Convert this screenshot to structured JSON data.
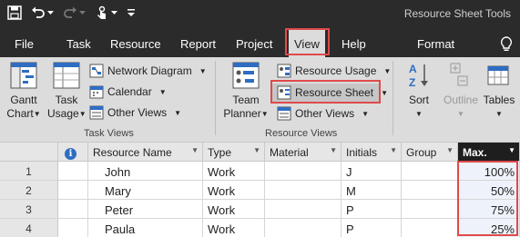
{
  "window": {
    "tools_title": "Resource Sheet Tools"
  },
  "tabs": [
    {
      "label": "File"
    },
    {
      "label": "Task"
    },
    {
      "label": "Resource"
    },
    {
      "label": "Report"
    },
    {
      "label": "Project"
    },
    {
      "label": "View"
    },
    {
      "label": "Help"
    },
    {
      "label": "Format"
    }
  ],
  "ribbon": {
    "task_views": {
      "group_label": "Task Views",
      "gantt_chart": [
        "Gantt",
        "Chart"
      ],
      "task_usage": [
        "Task",
        "Usage"
      ],
      "network_diagram": "Network Diagram",
      "calendar": "Calendar",
      "other_views": "Other Views"
    },
    "resource_views": {
      "group_label": "Resource Views",
      "team_planner": [
        "Team",
        "Planner"
      ],
      "resource_usage": "Resource Usage",
      "resource_sheet": "Resource Sheet",
      "other_views": "Other Views"
    },
    "data": {
      "sort": "Sort",
      "outline": "Outline",
      "tables": "Tables"
    }
  },
  "sheet": {
    "columns": [
      "Resource Name",
      "Type",
      "Material",
      "Initials",
      "Group",
      "Max."
    ],
    "rows": [
      {
        "num": "1",
        "name": "John",
        "type": "Work",
        "material": "",
        "initials": "J",
        "group": "",
        "max": "100%"
      },
      {
        "num": "2",
        "name": "Mary",
        "type": "Work",
        "material": "",
        "initials": "M",
        "group": "",
        "max": "50%"
      },
      {
        "num": "3",
        "name": "Peter",
        "type": "Work",
        "material": "",
        "initials": "P",
        "group": "",
        "max": "75%"
      },
      {
        "num": "4",
        "name": "Paula",
        "type": "Work",
        "material": "",
        "initials": "P",
        "group": "",
        "max": "25%"
      }
    ]
  },
  "colors": {
    "highlight": "#e04a4a",
    "titlebar": "#2b2b2b",
    "ribbon": "#dcdcdc"
  }
}
